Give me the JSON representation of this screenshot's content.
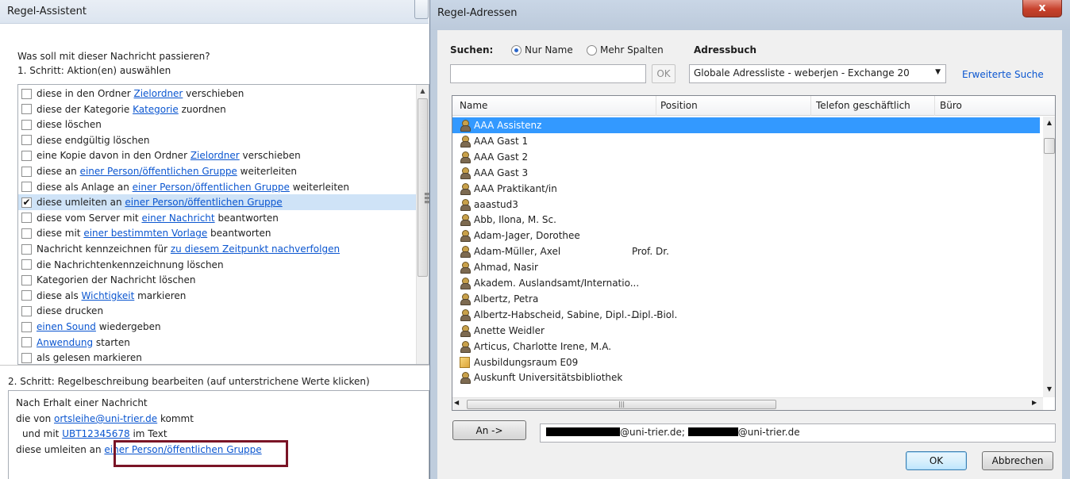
{
  "rule_wizard": {
    "title": "Regel-Assistent",
    "question": "Was soll mit dieser Nachricht passieren?",
    "step1": "1. Schritt: Aktion(en) auswählen",
    "actions": [
      {
        "pre": "diese in den Ordner ",
        "link": "Zielordner",
        "post": " verschieben",
        "checked": false
      },
      {
        "pre": "diese der Kategorie ",
        "link": "Kategorie",
        "post": " zuordnen",
        "checked": false
      },
      {
        "pre": "diese löschen",
        "link": "",
        "post": "",
        "checked": false
      },
      {
        "pre": "diese endgültig löschen",
        "link": "",
        "post": "",
        "checked": false
      },
      {
        "pre": "eine Kopie davon in den Ordner ",
        "link": "Zielordner",
        "post": " verschieben",
        "checked": false
      },
      {
        "pre": "diese an ",
        "link": "einer Person/öffentlichen Gruppe",
        "post": " weiterleiten",
        "checked": false
      },
      {
        "pre": "diese als Anlage an ",
        "link": "einer Person/öffentlichen Gruppe",
        "post": " weiterleiten",
        "checked": false
      },
      {
        "pre": "diese umleiten an ",
        "link": "einer Person/öffentlichen Gruppe",
        "post": "",
        "checked": true
      },
      {
        "pre": "diese vom Server mit ",
        "link": "einer Nachricht",
        "post": " beantworten",
        "checked": false
      },
      {
        "pre": "diese mit ",
        "link": "einer bestimmten Vorlage",
        "post": " beantworten",
        "checked": false
      },
      {
        "pre": "Nachricht kennzeichnen für ",
        "link": "zu diesem Zeitpunkt nachverfolgen",
        "post": "",
        "checked": false
      },
      {
        "pre": "die Nachrichtenkennzeichnung löschen",
        "link": "",
        "post": "",
        "checked": false
      },
      {
        "pre": "Kategorien der Nachricht löschen",
        "link": "",
        "post": "",
        "checked": false
      },
      {
        "pre": "diese als ",
        "link": "Wichtigkeit",
        "post": " markieren",
        "checked": false
      },
      {
        "pre": "diese drucken",
        "link": "",
        "post": "",
        "checked": false
      },
      {
        "pre": "",
        "link": "einen Sound",
        "post": " wiedergeben",
        "checked": false
      },
      {
        "pre": "",
        "link": "Anwendung",
        "post": " starten",
        "checked": false
      },
      {
        "pre": "als gelesen markieren",
        "link": "",
        "post": "",
        "checked": false
      }
    ],
    "step2": "2. Schritt: Regelbeschreibung bearbeiten (auf unterstrichene Werte klicken)",
    "description": {
      "line1": "Nach Erhalt einer Nachricht",
      "line2_pre": "die von ",
      "line2_link": "ortsleihe@uni-trier.de",
      "line2_post": " kommt",
      "line3_pre": "und mit ",
      "line3_link": "UBT12345678",
      "line3_post": " im Text",
      "line4_pre": "diese umleiten an ",
      "line4_link": "einer Person/öffentlichen Gruppe"
    },
    "highlight_color": "#7a1426"
  },
  "address_dialog": {
    "title": "Regel-Adressen",
    "close_glyph": "x",
    "search_label": "Suchen:",
    "radio_name_only": "Nur Name",
    "radio_name_only_selected": true,
    "radio_more_columns": "Mehr Spalten",
    "radio_more_columns_selected": false,
    "addressbook_label": "Adressbuch",
    "search_value": "",
    "search_ok": "OK",
    "addressbook_value": "Globale Adressliste - weberjen - Exchange 20",
    "advanced_search": "Erweiterte Suche",
    "columns": [
      "Name",
      "Position",
      "Telefon geschäftlich",
      "Büro"
    ],
    "rows": [
      {
        "name": "AAA Assistenz",
        "position": "",
        "type": "person",
        "selected": true
      },
      {
        "name": "AAA Gast 1",
        "position": "",
        "type": "person",
        "selected": false
      },
      {
        "name": "AAA Gast 2",
        "position": "",
        "type": "person",
        "selected": false
      },
      {
        "name": "AAA Gast 3",
        "position": "",
        "type": "person",
        "selected": false
      },
      {
        "name": "AAA Praktikant/in",
        "position": "",
        "type": "person",
        "selected": false
      },
      {
        "name": "aaastud3",
        "position": "",
        "type": "person",
        "selected": false
      },
      {
        "name": "Abb, Ilona, M. Sc.",
        "position": "",
        "type": "person",
        "selected": false
      },
      {
        "name": "Adam-Jager, Dorothee",
        "position": "",
        "type": "person",
        "selected": false
      },
      {
        "name": "Adam-Müller, Axel",
        "position": "Prof. Dr.",
        "type": "person",
        "selected": false
      },
      {
        "name": "Ahmad, Nasir",
        "position": "",
        "type": "person",
        "selected": false
      },
      {
        "name": "Akadem. Auslandsamt/Internatio...",
        "position": "",
        "type": "person",
        "selected": false
      },
      {
        "name": "Albertz, Petra",
        "position": "",
        "type": "person",
        "selected": false
      },
      {
        "name": "Albertz-Habscheid, Sabine, Dipl.-...",
        "position": "Dipl.-Biol.",
        "type": "person",
        "selected": false
      },
      {
        "name": "Anette Weidler",
        "position": "",
        "type": "person",
        "selected": false
      },
      {
        "name": "Articus, Charlotte Irene, M.A.",
        "position": "",
        "type": "person",
        "selected": false
      },
      {
        "name": "Ausbildungsraum E09",
        "position": "",
        "type": "room",
        "selected": false
      },
      {
        "name": "Auskunft Universitätsbibliothek",
        "position": "",
        "type": "person",
        "selected": false
      }
    ],
    "to_button": "An ->",
    "to_value_part1": "@uni-trier.de; ",
    "to_value_part2": "@uni-trier.de",
    "ok_button": "OK",
    "cancel_button": "Abbrechen",
    "selection_color": "#3399ff",
    "link_color": "#0b56d0",
    "close_color": "#c7412c"
  }
}
